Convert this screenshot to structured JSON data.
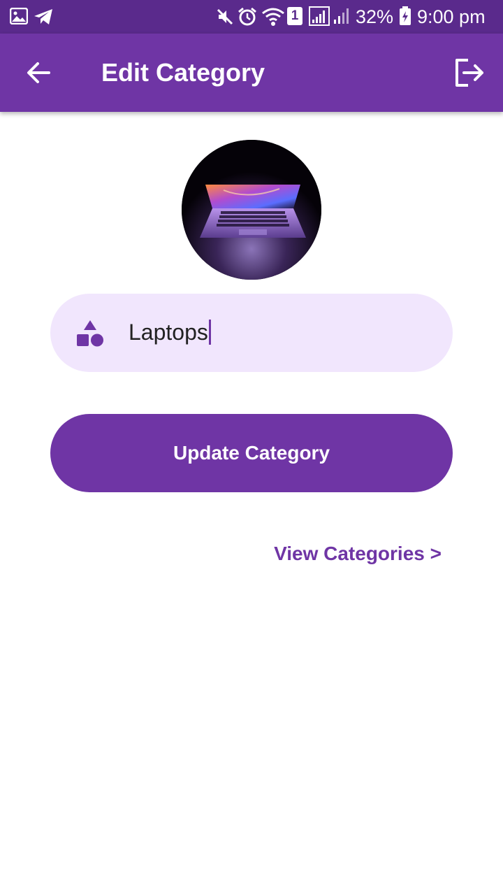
{
  "status_bar": {
    "battery": "32%",
    "time": "9:00 pm",
    "sim_slot": "1",
    "icons": [
      "image-icon",
      "telegram-icon",
      "mute-icon",
      "alarm-icon",
      "wifi-icon",
      "sim-icon",
      "signal-icon",
      "signal-weak-icon",
      "battery-charging-icon"
    ]
  },
  "app_bar": {
    "title": "Edit Category",
    "back_icon": "arrow-left-icon",
    "logout_icon": "logout-icon"
  },
  "category_image": {
    "subject": "laptop"
  },
  "form": {
    "name_value": "Laptops",
    "field_icon": "category-icon"
  },
  "update_button": {
    "label": "Update Category"
  },
  "view_link": {
    "label": "View Categories >"
  },
  "colors": {
    "primary": "#6f35a5",
    "status_bar": "#5a2a8c",
    "input_background": "#f1e6fd"
  }
}
